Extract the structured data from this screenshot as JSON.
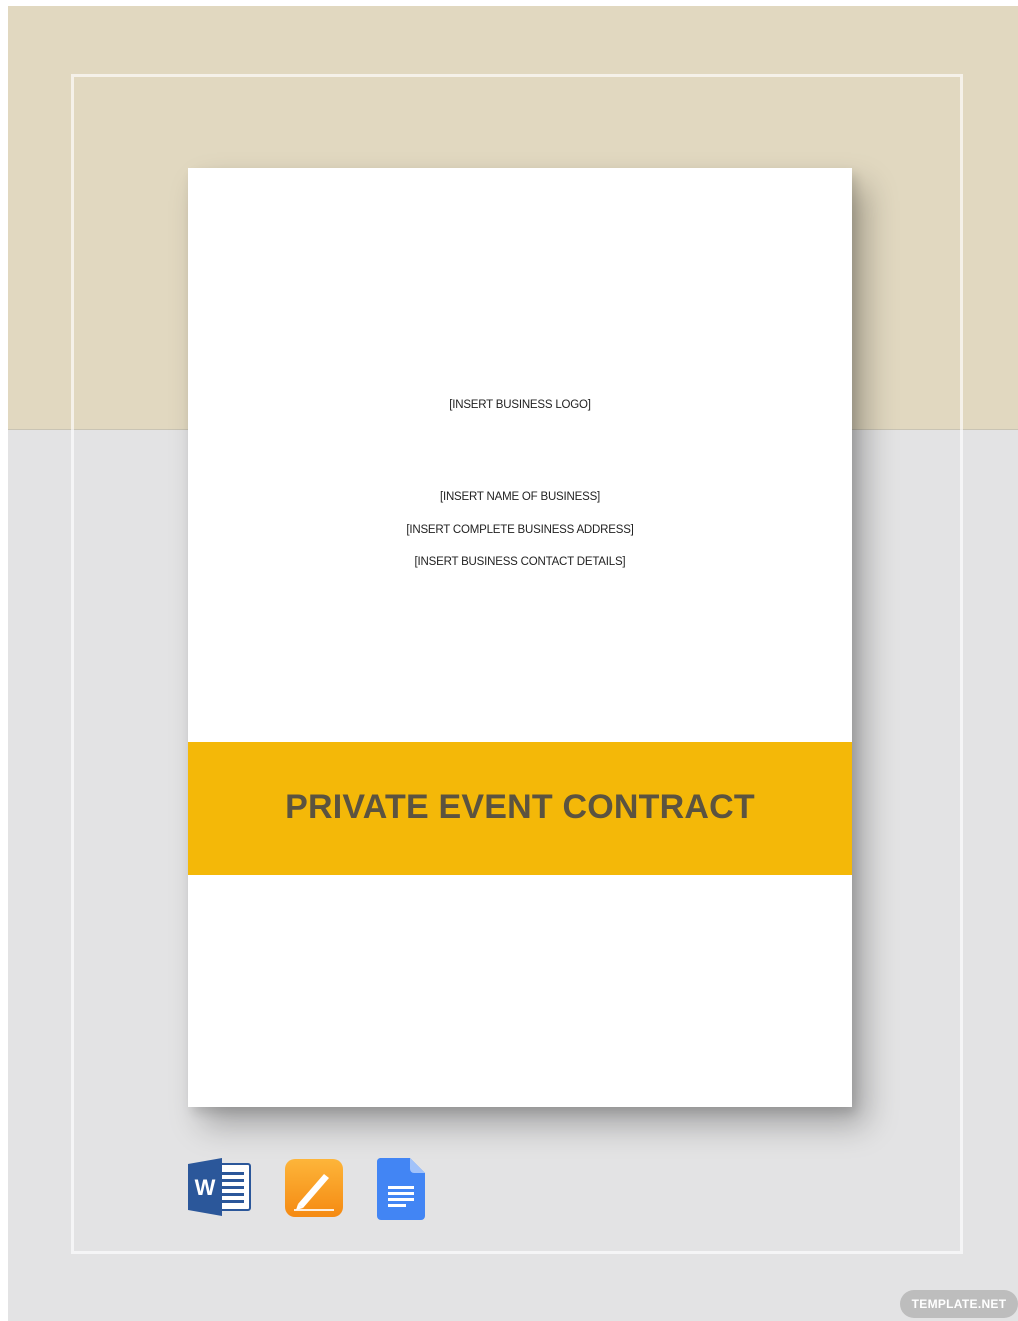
{
  "document": {
    "logo_placeholder": "[INSERT BUSINESS LOGO]",
    "business_name": "[INSERT NAME OF BUSINESS]",
    "business_address": "[INSERT COMPLETE BUSINESS ADDRESS]",
    "business_contact": "[INSERT BUSINESS CONTACT DETAILS]",
    "title": "PRIVATE EVENT CONTRACT"
  },
  "format_icons": [
    "word-icon",
    "pages-icon",
    "google-docs-icon"
  ],
  "watermark": "TEMPLATE.NET",
  "colors": {
    "top_background": "#e1d8c0",
    "bottom_background": "#e3e3e4",
    "title_band": "#f4b808",
    "title_text": "#5b5340",
    "word_blue": "#2b579a",
    "pages_orange": "#f7a21b",
    "docs_blue": "#4285f4"
  }
}
